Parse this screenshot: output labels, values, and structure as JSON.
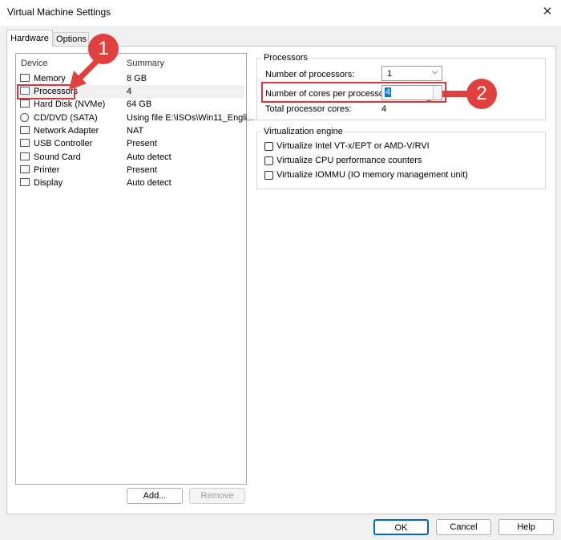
{
  "window": {
    "title": "Virtual Machine Settings"
  },
  "tabs": [
    {
      "label": "Hardware"
    },
    {
      "label": "Options"
    }
  ],
  "device_list": {
    "headers": {
      "device": "Device",
      "summary": "Summary"
    },
    "rows": [
      {
        "icon": "memory-icon",
        "name": "Memory",
        "summary": "8 GB"
      },
      {
        "icon": "processor-icon",
        "name": "Processors",
        "summary": "4"
      },
      {
        "icon": "hard-disk-icon",
        "name": "Hard Disk (NVMe)",
        "summary": "64 GB"
      },
      {
        "icon": "cd-dvd-icon",
        "name": "CD/DVD (SATA)",
        "summary": "Using file E:\\ISOs\\Win11_Engli..."
      },
      {
        "icon": "network-adapter-icon",
        "name": "Network Adapter",
        "summary": "NAT"
      },
      {
        "icon": "usb-icon",
        "name": "USB Controller",
        "summary": "Present"
      },
      {
        "icon": "sound-card-icon",
        "name": "Sound Card",
        "summary": "Auto detect"
      },
      {
        "icon": "printer-icon",
        "name": "Printer",
        "summary": "Present"
      },
      {
        "icon": "display-icon",
        "name": "Display",
        "summary": "Auto detect"
      }
    ],
    "add_button": "Add...",
    "remove_button": "Remove"
  },
  "processors": {
    "group_label": "Processors",
    "num_processors_label": "Number of processors:",
    "num_processors_value": "1",
    "cores_label": "Number of cores per processor:",
    "cores_value": "4",
    "total_label": "Total processor cores:",
    "total_value": "4"
  },
  "virtualization": {
    "group_label": "Virtualization engine",
    "options": [
      {
        "label": "Virtualize Intel VT-x/EPT or AMD-V/RVI",
        "checked": false
      },
      {
        "label": "Virtualize CPU performance counters",
        "checked": false
      },
      {
        "label": "Virtualize IOMMU (IO memory management unit)",
        "checked": false
      }
    ]
  },
  "annotations": {
    "badge1": "1",
    "badge2": "2",
    "color": "#e0413f"
  },
  "footer": {
    "ok": "OK",
    "cancel": "Cancel",
    "help": "Help"
  }
}
